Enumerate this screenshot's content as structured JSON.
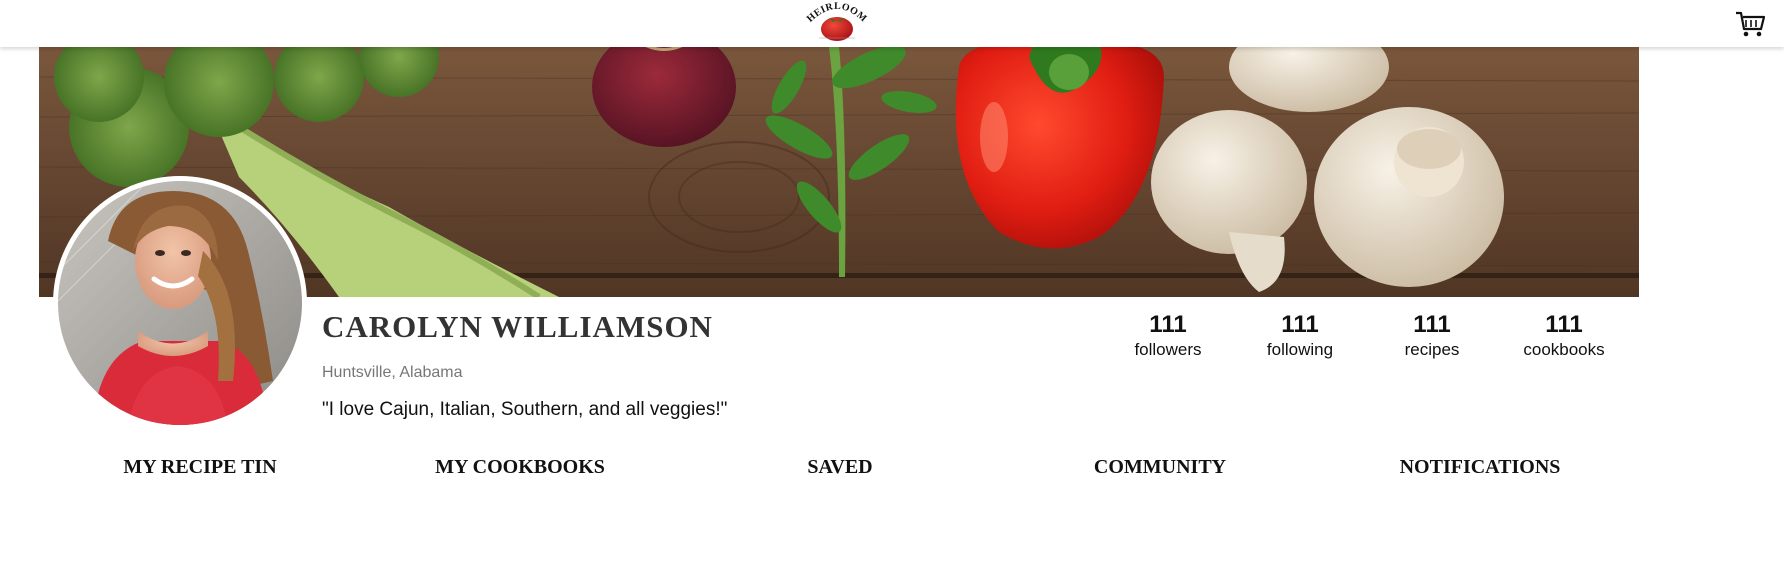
{
  "header": {
    "logo_text": "HEIRLOOM",
    "logo_icon": "tomato-icon",
    "cart_icon": "shopping-cart-icon"
  },
  "banner": {
    "description_icon": "vegetables-banner-image"
  },
  "profile": {
    "name": "CAROLYN WILLIAMSON",
    "location": "Huntsville, Alabama",
    "bio": "\"I love Cajun, Italian, Southern, and all veggies!\"",
    "avatar_icon": "avatar-photo"
  },
  "stats": [
    {
      "value": "111",
      "label": "followers"
    },
    {
      "value": "111",
      "label": "following"
    },
    {
      "value": "111",
      "label": "recipes"
    },
    {
      "value": "111",
      "label": "cookbooks"
    }
  ],
  "tabs": [
    {
      "label": "MY RECIPE TIN"
    },
    {
      "label": "MY COOKBOOKS"
    },
    {
      "label": "SAVED"
    },
    {
      "label": "COMMUNITY"
    },
    {
      "label": "NOTIFICATIONS"
    }
  ],
  "colors": {
    "name": "#333333",
    "location": "#777777",
    "text": "#111111",
    "tomato": "#d0191e"
  }
}
